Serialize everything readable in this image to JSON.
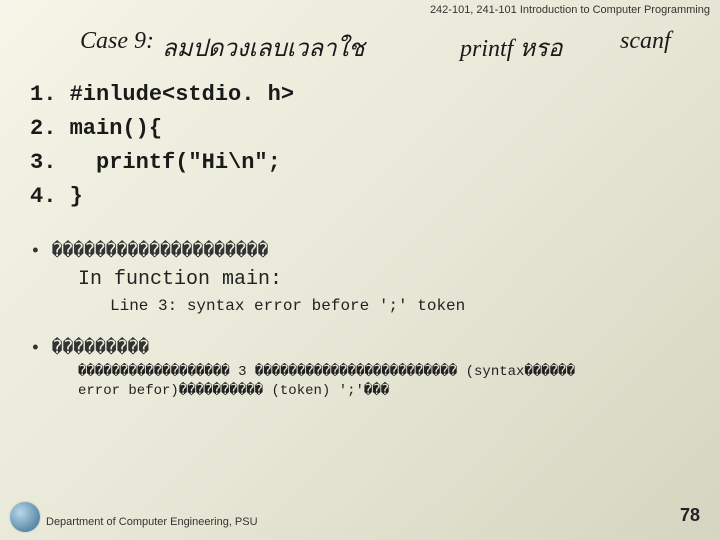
{
  "header": {
    "course": "242-101, 241-101 Introduction to Computer Programming"
  },
  "title": {
    "case_label": "Case 9:",
    "thai": "ลมปดวงเลบเวลาใช",
    "printf": "printf หรอ",
    "scanf": "scanf"
  },
  "code": {
    "line1": "1. #inlude<stdio. h>",
    "line2": "2. main(){",
    "line3": "3.   printf(\"Hi\\n\";",
    "line4": "4. }"
  },
  "bullets": {
    "b1_head": "• ��������������������",
    "b1_sub": "In function main:",
    "b1_sub2": "Line 3: syntax error before ';' token",
    "b2_head": "• ���������",
    "b2_body1": "������������������ 3 ������������������������ (syntax������",
    "b2_body2": "error befor)���������� (token) ';'���"
  },
  "footer": {
    "dept": "Department of Computer Engineering, PSU",
    "page": "78"
  }
}
